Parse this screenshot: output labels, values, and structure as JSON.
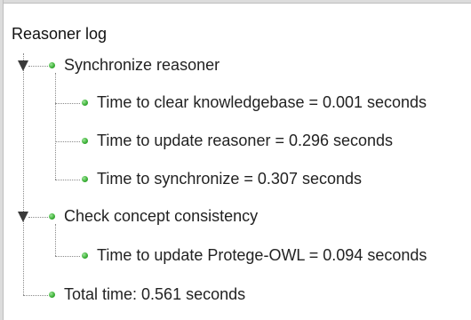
{
  "panel": {
    "title": "Reasoner log"
  },
  "tree": {
    "sync": {
      "label": "Synchronize reasoner",
      "expanded": true,
      "children": [
        "Time to clear knowledgebase = 0.001 seconds",
        "Time to update reasoner = 0.296 seconds",
        "Time to synchronize = 0.307 seconds"
      ]
    },
    "consistency": {
      "label": "Check concept consistency",
      "expanded": true,
      "children": [
        "Time to update Protege-OWL = 0.094 seconds"
      ]
    },
    "total": {
      "label": "Total time: 0.561 seconds"
    }
  },
  "colors": {
    "bullet": "#3fb33a",
    "toggle": "#3a3a3a",
    "connector": "#8a8a8a"
  },
  "icons": {
    "expander": "triangle-down-icon",
    "node": "green-dot-icon"
  }
}
